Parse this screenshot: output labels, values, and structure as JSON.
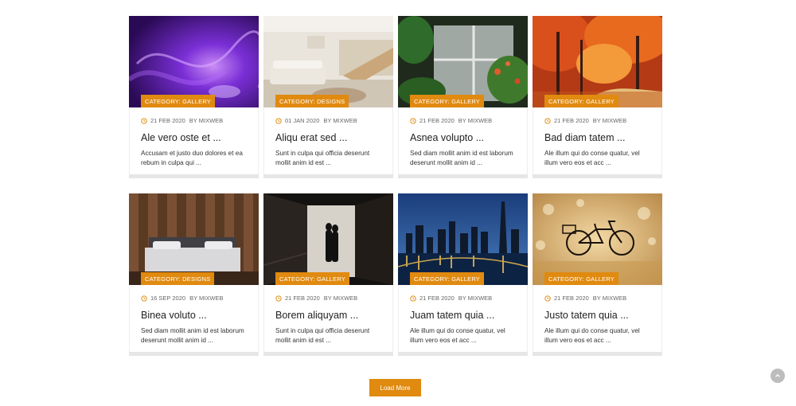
{
  "cards": [
    {
      "category": "Category: Gallery",
      "date": "21 Feb 2020",
      "author": "By Mixweb",
      "title": "Ale vero oste et ...",
      "excerpt": "Accusam et justo duo dolores et ea rebum in culpa qui ..."
    },
    {
      "category": "Category: Designs",
      "date": "01 Jan 2020",
      "author": "By Mixweb",
      "title": "Aliqu erat sed ...",
      "excerpt": "Sunt in culpa qui officia deserunt mollit anim id est ..."
    },
    {
      "category": "Category: Gallery",
      "date": "21 Feb 2020",
      "author": "By Mixweb",
      "title": "Asnea volupto ...",
      "excerpt": "Sed diam mollit anim id est laborum deserunt mollit anim id ..."
    },
    {
      "category": "Category: Gallery",
      "date": "21 Feb 2020",
      "author": "By Mixweb",
      "title": "Bad diam tatem ...",
      "excerpt": "Ale illum qui do conse quatur, vel illum vero eos et acc ..."
    },
    {
      "category": "Category: Designs",
      "date": "16 Sep 2020",
      "author": "By Mixweb",
      "title": "Binea voluto ...",
      "excerpt": "Sed diam mollit anim id est laborum deserunt mollit anim id ..."
    },
    {
      "category": "Category: Gallery",
      "date": "21 Feb 2020",
      "author": "By Mixweb",
      "title": "Borem aliquyam ...",
      "excerpt": "Sunt in culpa qui officia deserunt mollit anim id est ..."
    },
    {
      "category": "Category: Gallery",
      "date": "21 Feb 2020",
      "author": "By Mixweb",
      "title": "Juam tatem quia ...",
      "excerpt": "Ale illum qui do conse quatur, vel illum vero eos et acc ..."
    },
    {
      "category": "Category: Gallery",
      "date": "21 Feb 2020",
      "author": "By Mixweb",
      "title": "Justo tatem quia ...",
      "excerpt": "Ale illum qui do conse quatur, vel illum vero eos et acc ..."
    }
  ],
  "load_more": "Load More",
  "colors": {
    "accent": "#e08a10",
    "background": "#ffffff",
    "card_bar": "#e6e6e6",
    "to_top": "#bdbdbd"
  },
  "icons": {
    "meta": "clock-icon",
    "scroll_top": "chevron-up-icon"
  }
}
